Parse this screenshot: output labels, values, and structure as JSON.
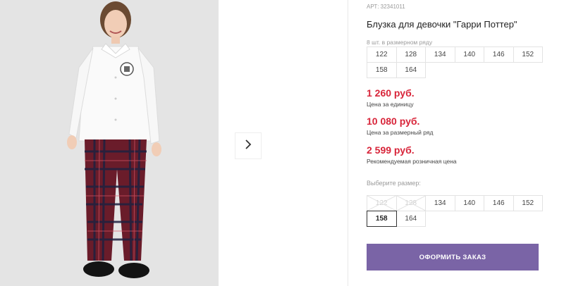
{
  "product": {
    "article": "АРТ: 32341011",
    "title": "Блузка для девочки \"Гарри Поттер\""
  },
  "pack": {
    "note": "8 шт. в размерном ряду",
    "sizes": [
      "122",
      "128",
      "134",
      "140",
      "146",
      "152",
      "158",
      "164"
    ]
  },
  "prices": {
    "unit_price": "1 260 руб.",
    "unit_label": "Цена за единицу",
    "pack_price": "10 080 руб.",
    "pack_label": "Цена за размерный ряд",
    "retail_price": "2 599 руб.",
    "retail_label": "Рекомендуемая розничная цена"
  },
  "size_select": {
    "label": "Выберите размер:",
    "sizes": [
      "122",
      "128",
      "134",
      "140",
      "146",
      "152",
      "158",
      "164"
    ],
    "disabled": [
      "122",
      "128"
    ],
    "selected": "158"
  },
  "order_button": "ОФОРМИТЬ ЗАКАЗ",
  "colors": {
    "price": "#d8253a",
    "button": "#7a64a6"
  },
  "icons": {
    "next": "chevron-right-icon"
  }
}
